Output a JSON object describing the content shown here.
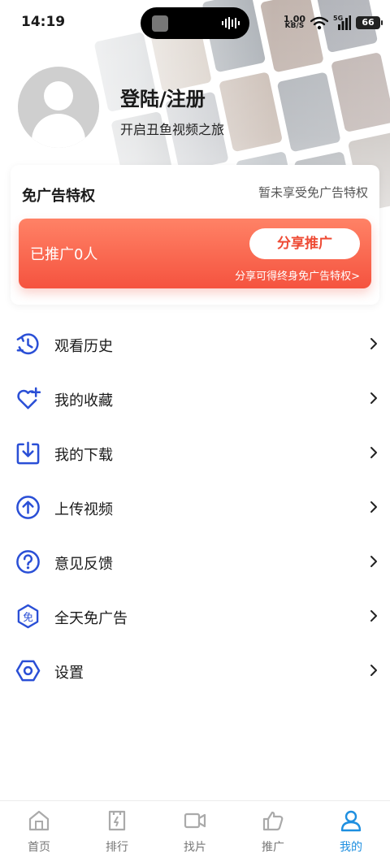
{
  "status_bar": {
    "time": "14:19",
    "net_speed_value": "1.00",
    "net_speed_unit": "KB/S",
    "signal_label": "5G",
    "battery": "66"
  },
  "profile": {
    "title": "登陆/注册",
    "subtitle": "开启丑鱼视频之旅"
  },
  "ad_free": {
    "title": "免广告特权",
    "status": "暂未享受免广告特权",
    "promoted_count": "已推广0人",
    "share_button": "分享推广",
    "share_hint": "分享可得终身免广告特权>"
  },
  "menu": {
    "items": [
      {
        "label": "观看历史",
        "icon": "history-icon"
      },
      {
        "label": "我的收藏",
        "icon": "heart-plus-icon"
      },
      {
        "label": "我的下载",
        "icon": "download-icon"
      },
      {
        "label": "上传视频",
        "icon": "upload-icon"
      },
      {
        "label": "意见反馈",
        "icon": "question-icon"
      },
      {
        "label": "全天免广告",
        "icon": "ad-free-icon"
      },
      {
        "label": "设置",
        "icon": "settings-icon"
      }
    ]
  },
  "bottom_nav": {
    "items": [
      {
        "label": "首页",
        "icon": "home-icon"
      },
      {
        "label": "排行",
        "icon": "ranking-icon"
      },
      {
        "label": "找片",
        "icon": "video-icon"
      },
      {
        "label": "推广",
        "icon": "promote-icon"
      },
      {
        "label": "我的",
        "icon": "user-icon"
      }
    ],
    "active_index": 4
  },
  "colors": {
    "accent_blue": "#1e8fe0",
    "icon_blue": "#2a4fd6",
    "promo_red": "#f5533f"
  }
}
